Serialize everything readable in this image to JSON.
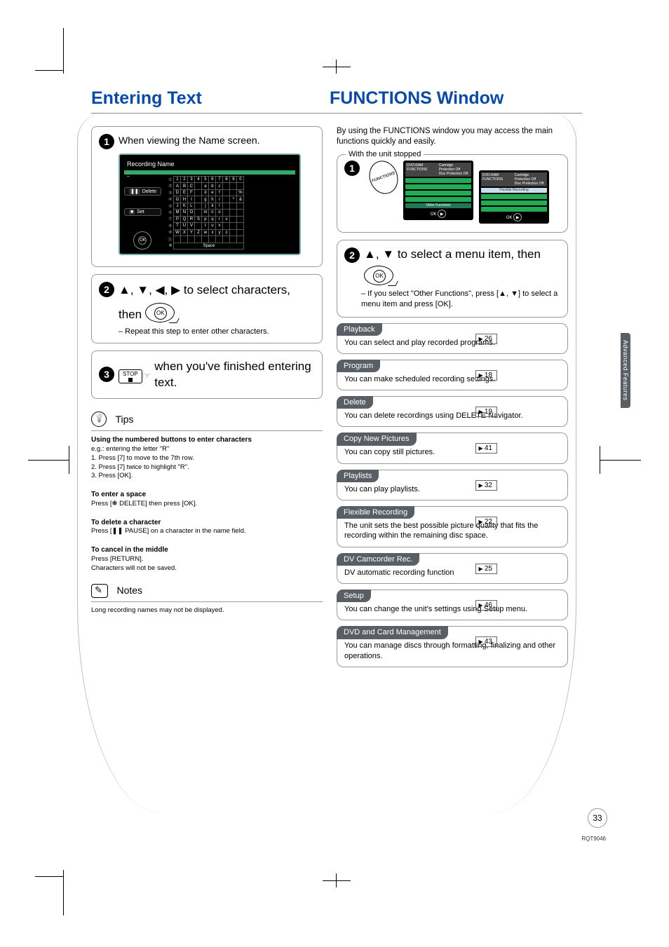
{
  "page": {
    "number": "33",
    "footcode": "RQT9046"
  },
  "sidetab": "Advanced Features",
  "titles": {
    "left": "Entering Text",
    "right": "FUNCTIONS Window"
  },
  "left": {
    "step1": {
      "text": "When viewing the Name screen.",
      "screentitle": "Recording Name",
      "space_label": "Space",
      "btn_delete": "Delete",
      "btn_set": "Set",
      "ok": "OK",
      "rowlabels": [
        "①",
        "②",
        "③",
        "④",
        "⑤",
        "⑥",
        "⑦",
        "⑧",
        "⑨",
        "⓪"
      ]
    },
    "step2": {
      "text_prefix": "▲, ▼, ◀, ▶ to select characters, then ",
      "ok": "OK",
      "sub": "– Repeat this step to enter other characters."
    },
    "step3": {
      "stop": "STOP",
      "text": " when you've finished entering text."
    },
    "tips": {
      "heading": "Tips",
      "t1": "Using the numbered buttons to enter characters",
      "eg": "e.g.: entering the letter \"R\"",
      "l1": "1. Press [7] to move to the 7th row.",
      "l2": "2. Press [7] twice to highlight \"R\".",
      "l3": "3. Press [OK].",
      "sp_h": "To enter a space",
      "sp_b": "Press [❋ DELETE] then press [OK].",
      "del_h": "To delete a character",
      "del_b": "Press [❚❚ PAUSE] on a character in the name field.",
      "can_h": "To cancel in the middle",
      "can_b1": "Press [RETURN].",
      "can_b2": "Characters will not be saved."
    },
    "notes": {
      "heading": "Notes",
      "body": "Long recording names may not be displayed."
    }
  },
  "right": {
    "intro": "By using the FUNCTIONS window you may access the main functions quickly and easily.",
    "step1": {
      "label": "With the unit stopped",
      "functions_badge": "FUNCTIONS",
      "ok": "OK",
      "scr1": {
        "hdr_l": "DVD-RAM  FUNCTIONS",
        "hdr_r1": "Cartridge Protection Off",
        "hdr_r2": "Disc Protection Off",
        "item_other": "Other Functions"
      },
      "scr2": {
        "hdr_l": "DVD-RAM  FUNCTIONS",
        "hdr_r1": "Cartridge Protection Off",
        "hdr_r2": "Disc Protection Off",
        "item_fr": "Flexible Recording"
      }
    },
    "step2": {
      "text_prefix": "▲, ▼ to select a menu item, then ",
      "ok": "OK",
      "sub": "– If you select \"Other Functions\", press [▲, ▼] to select a menu item and press [OK]."
    },
    "functions": [
      {
        "name": "Playback",
        "page": "26",
        "desc": "You can select and play recorded programs."
      },
      {
        "name": "Program",
        "page": "18",
        "desc": "You can make scheduled recording settings."
      },
      {
        "name": "Delete",
        "page": "19",
        "desc": "You can delete recordings using DELETE Navigator."
      },
      {
        "name": "Copy New Pictures",
        "page": "41",
        "desc": "You can copy still pictures."
      },
      {
        "name": "Playlists",
        "page": "32",
        "desc": "You can play playlists."
      },
      {
        "name": "Flexible Recording",
        "page": "22",
        "desc": "The unit sets the best possible picture quality that fits the recording within the remaining disc space."
      },
      {
        "name": "DV Camcorder Rec.",
        "page": "25",
        "desc": "DV automatic recording function"
      },
      {
        "name": "Setup",
        "page": "46",
        "desc": "You can change the unit's settings using Setup menu."
      },
      {
        "name": "DVD and Card Management",
        "page": "43",
        "desc": "You can manage discs through formatting, finalizing and other operations."
      }
    ]
  },
  "chart_data": {
    "type": "table",
    "note": "character selection grid rows 1-0 with A-Z 0-9 symbols; visual keyboard only"
  }
}
